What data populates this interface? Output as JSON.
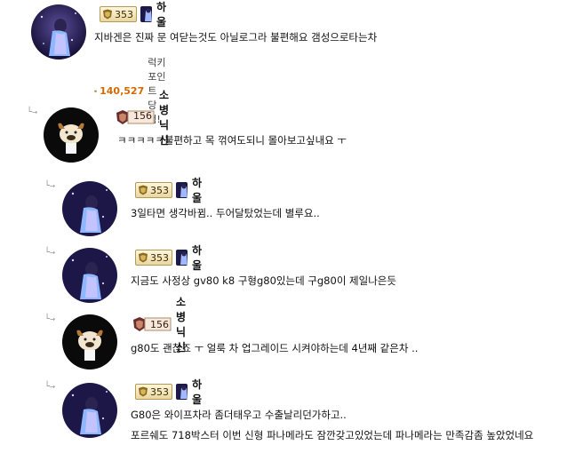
{
  "comments": [
    {
      "nick": "하울",
      "level": "353",
      "lines": [
        "지바겐은 진짜 문 여닫는것도 아닐로그라 불편해요 갬성으로타는차"
      ],
      "points": "140,527",
      "points_suffix": "럭키포인트 당첨!"
    },
    {
      "nick": "소병닉신",
      "level": "156",
      "lines": [
        "ㅋㅋㅋㅋㅋ불편하고 목 꺾여도되니 몰아보고싶내요 ㅜ"
      ]
    },
    {
      "nick": "하울",
      "level": "353",
      "lines": [
        "3일타면 생각바뀜.. 두어달탔었는데 별루요.."
      ]
    },
    {
      "nick": "하울",
      "level": "353",
      "lines": [
        "지금도 사정상 gv80 k8 구형g80있는데 구g80이 제일나은듯"
      ]
    },
    {
      "nick": "소병닉신",
      "level": "156",
      "lines": [
        "g80도 괜찮죠 ㅜ 얼룩 차 업그레이드 시켜야하는데 4년째 같은차 .."
      ]
    },
    {
      "nick": "하울",
      "level": "353",
      "lines": [
        "G80은 와이프차라 좀더태우고 수출날리던가하고..",
        "포르쉐도 718박스터 이번 신형 파나메라도 잠깐갖고있었는데 파나메라는 만족감좀 높았었네요"
      ]
    }
  ],
  "colors": {
    "points": "#d46a00",
    "separator": "#e6e6e6"
  },
  "icons": {
    "points": "gift-icon",
    "reply": "reply-arrow-icon"
  }
}
